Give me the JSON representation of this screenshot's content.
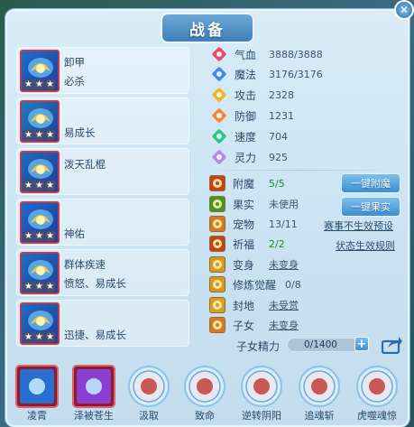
{
  "window": {
    "title": "战备",
    "close_label": "✕"
  },
  "skill_cards": [
    {
      "line1": "卸甲",
      "line2": "必杀",
      "icon": "armor-break-skill-icon",
      "stars": 3
    },
    {
      "line1": "",
      "line2": "易成长",
      "icon": "growth-skill-icon",
      "stars": 3
    },
    {
      "line1": "泼天乱棍",
      "line2": "",
      "icon": "staff-skill-icon",
      "stars": 3
    },
    {
      "line1": "",
      "line2": "神佑",
      "icon": "divine-blessing-skill-icon",
      "stars": 3
    },
    {
      "line1": "群体疾速",
      "line2": "愤怒、易成长",
      "icon": "haste-skill-icon",
      "stars": 3
    },
    {
      "line1": "",
      "line2": "迅捷、易成长",
      "icon": "swift-skill-icon",
      "stars": 3
    }
  ],
  "stats": [
    {
      "label": "气血",
      "value": "3888/3888",
      "icon": "heart-icon",
      "color": "#e84b6a"
    },
    {
      "label": "魔法",
      "value": "3176/3176",
      "icon": "magic-diamond-icon",
      "color": "#3f8fe0"
    },
    {
      "label": "攻击",
      "value": "2328",
      "icon": "attack-icon",
      "color": "#f0b42a"
    },
    {
      "label": "防御",
      "value": "1231",
      "icon": "defense-shield-icon",
      "color": "#f08a3a"
    },
    {
      "label": "速度",
      "value": "704",
      "icon": "speed-icon",
      "color": "#2fc48a"
    },
    {
      "label": "灵力",
      "value": "925",
      "icon": "spirit-icon",
      "color": "#b78ae6"
    }
  ],
  "extras": [
    {
      "label": "附魔",
      "value": "5/5",
      "icon": "enchant-icon",
      "green": true,
      "underline": false
    },
    {
      "label": "果实",
      "value": "未使用",
      "icon": "fruit-icon",
      "green": false,
      "underline": false
    },
    {
      "label": "宠物",
      "value": "13/11",
      "icon": "pet-icon",
      "green": false,
      "underline": false
    },
    {
      "label": "祈福",
      "value": "2/2",
      "icon": "blessing-icon",
      "green": true,
      "underline": false
    },
    {
      "label": "变身",
      "value": "未变身",
      "icon": "transform-icon",
      "green": false,
      "underline": true
    },
    {
      "label": "修炼觉醒",
      "value": "0/8",
      "icon": "cultivation-icon",
      "green": false,
      "underline": false
    },
    {
      "label": "封地",
      "value": "未受赏",
      "icon": "fief-icon",
      "green": false,
      "underline": true
    },
    {
      "label": "子女",
      "value": "未变身",
      "icon": "child-icon",
      "green": false,
      "underline": true
    }
  ],
  "buttons": {
    "one_click_enchant": "一键附魔",
    "one_click_fruit": "一键果实",
    "pet_link": "赛事不生效预设",
    "status_link": "状态生效规则"
  },
  "child_energy": {
    "label": "子女精力",
    "value": "0/1400",
    "plus": "+"
  },
  "bottom_skills": [
    {
      "name": "凌霄",
      "icon": "lingxiao-skill-icon",
      "bg": "#2a6fd0",
      "framed": true
    },
    {
      "name": "泽被苍生",
      "icon": "zebei-skill-icon",
      "bg": "#8a3fd0",
      "framed": true
    },
    {
      "name": "汲取",
      "icon": "absorb-skill-icon",
      "bg": "#e8e8f0",
      "framed": false
    },
    {
      "name": "致命",
      "icon": "lethal-skill-icon",
      "bg": "#e8e8f0",
      "framed": false
    },
    {
      "name": "逆转阴阳",
      "icon": "yin-yang-icon",
      "bg": "#e8e8f0",
      "framed": false
    },
    {
      "name": "追魂斩",
      "icon": "soul-slash-skill-icon",
      "bg": "#e8e8f0",
      "framed": false
    },
    {
      "name": "虎噬魂惊",
      "icon": "tiger-soul-skill-icon",
      "bg": "#e8e8f0",
      "framed": false
    }
  ]
}
